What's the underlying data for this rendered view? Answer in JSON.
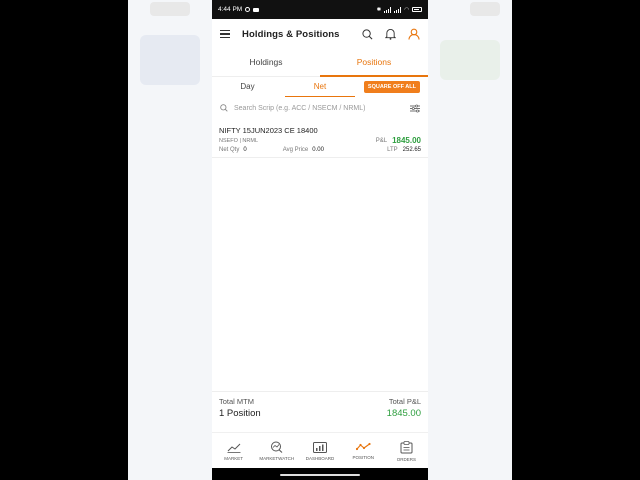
{
  "status_bar": {
    "time": "4:44 PM"
  },
  "app": {
    "title": "Holdings & Positions"
  },
  "tabs": [
    {
      "label": "Holdings",
      "active": false
    },
    {
      "label": "Positions",
      "active": true
    }
  ],
  "sub_tabs": [
    {
      "label": "Day",
      "active": false
    },
    {
      "label": "Net",
      "active": true
    }
  ],
  "square_off_label": "SQUARE OFF ALL",
  "search": {
    "placeholder": "Search Scrip (e.g. ACC / NSECM / NRML)"
  },
  "position": {
    "scrip": "NIFTY 15JUN2023 CE 18400",
    "exchange": "NSEFO | NRML",
    "pnl_label": "P&L",
    "pnl_value": "1845.00",
    "net_qty_label": "Net Qty",
    "net_qty_value": "0",
    "avg_price_label": "Avg Price",
    "avg_price_value": "0.00",
    "ltp_label": "LTP",
    "ltp_value": "252.65"
  },
  "summary": {
    "total_mtm_label": "Total MTM",
    "positions_count": "1 Position",
    "total_pnl_label": "Total P&L",
    "total_pnl_value": "1845.00"
  },
  "nav": [
    {
      "label": "MARKET",
      "icon": "market-icon"
    },
    {
      "label": "MARKETWATCH",
      "icon": "marketwatch-icon"
    },
    {
      "label": "DASHBOARD",
      "icon": "dashboard-icon"
    },
    {
      "label": "POSITION",
      "icon": "position-icon",
      "active": true
    },
    {
      "label": "ORDERS",
      "icon": "orders-icon"
    }
  ],
  "colors": {
    "accent": "#e8750d",
    "profit": "#2e9e3f"
  }
}
